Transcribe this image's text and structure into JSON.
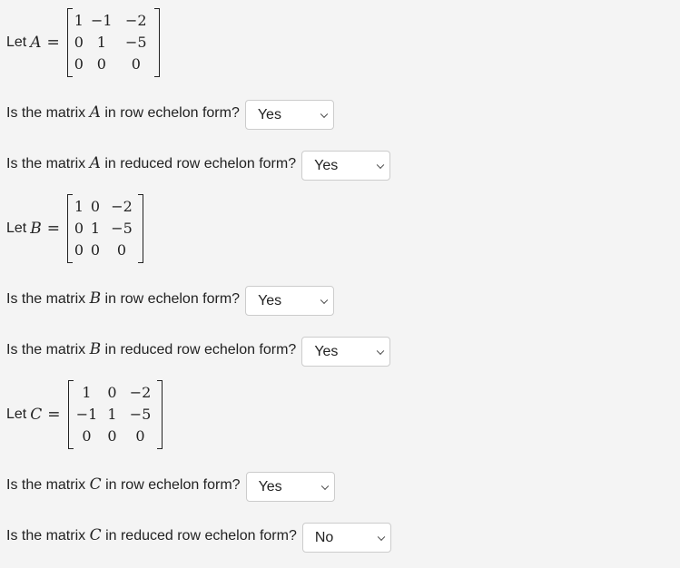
{
  "let_prefix": "Let",
  "equals": "=",
  "matrices": [
    {
      "name": "A",
      "rows": [
        [
          "1",
          "−1",
          "−2"
        ],
        [
          "0",
          "1",
          "−5"
        ],
        [
          "0",
          "0",
          "0"
        ]
      ],
      "q1_pre": "Is the matrix",
      "q1_post": "in row echelon form?",
      "q1_answer": "Yes",
      "q2_pre": "Is the matrix",
      "q2_post": "in reduced row echelon form?",
      "q2_answer": "Yes"
    },
    {
      "name": "B",
      "rows": [
        [
          "1",
          "0",
          "−2"
        ],
        [
          "0",
          "1",
          "−5"
        ],
        [
          "0",
          "0",
          "0"
        ]
      ],
      "q1_pre": "Is the matrix",
      "q1_post": "in row echelon form?",
      "q1_answer": "Yes",
      "q2_pre": "Is the matrix",
      "q2_post": "in reduced row echelon form?",
      "q2_answer": "Yes"
    },
    {
      "name": "C",
      "rows": [
        [
          "1",
          "0",
          "−2"
        ],
        [
          "−1",
          "1",
          "−5"
        ],
        [
          "0",
          "0",
          "0"
        ]
      ],
      "q1_pre": "Is the matrix",
      "q1_post": "in row echelon form?",
      "q1_answer": "Yes",
      "q2_pre": "Is the matrix",
      "q2_post": "in reduced row echelon form?",
      "q2_answer": "No"
    }
  ]
}
